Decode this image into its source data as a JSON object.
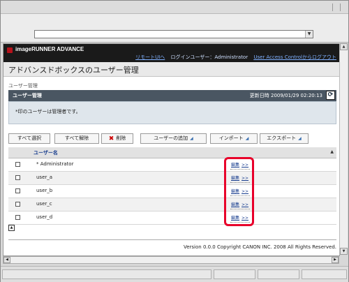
{
  "browser": {
    "drop_glyph": "▼",
    "scroll_up": "▲",
    "scroll_down": "▼",
    "scroll_left": "◀",
    "scroll_right": "▶"
  },
  "header": {
    "brand": "imageRUNNER ADVANCE",
    "remote_ui_link": "リモートUIへ",
    "user_label": "ログインユーザー：Administrator",
    "logout_link": "User Access Controlからログアウト"
  },
  "page": {
    "title": "アドバンスドボックスのユーザー管理",
    "breadcrumb": "ユーザー管理"
  },
  "panel": {
    "title": "ユーザー管理",
    "updated": "更新日時  2009/01/29 02:20:13",
    "refresh_icon": "⟳",
    "note": "*印のユーザーは管理者です。"
  },
  "toolbar": {
    "select_all": "すべて選択",
    "clear_all": "すべて解除",
    "delete_icon": "✖",
    "delete": "削除",
    "add_user": "ユーザーの追加",
    "import": "インポート",
    "export": "エクスポート",
    "menu_arrow": "◢"
  },
  "table": {
    "header_name": "ユーザー名",
    "sort_icon": "▲",
    "edit_label": "編集",
    "edit_chevron": ">>",
    "rows": [
      {
        "name": "* Administrator"
      },
      {
        "name": "user_a"
      },
      {
        "name": "user_b"
      },
      {
        "name": "user_c"
      },
      {
        "name": "user_d"
      }
    ]
  },
  "footer": {
    "page_top_icon": "▲",
    "copyright": "Version 0.0.0 Copyright CANON INC. 2008 All Rights Reserved."
  },
  "colors": {
    "highlight": "#e8002a",
    "panel_head": "#4a5662",
    "link": "#1a3f8f"
  }
}
